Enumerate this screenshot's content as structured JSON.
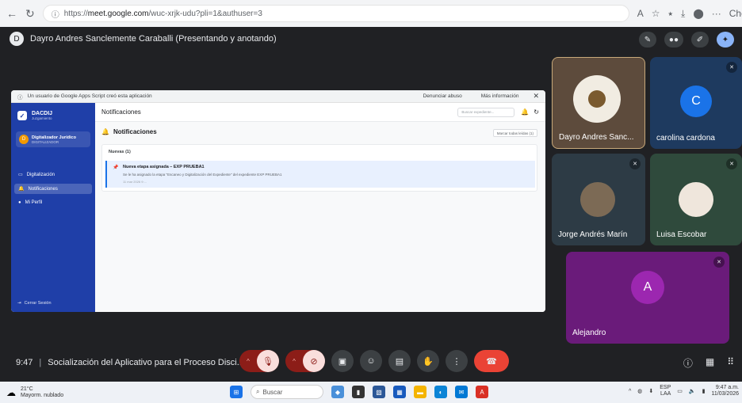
{
  "browser": {
    "url_prefix": "https://",
    "url_host": "meet.google.com",
    "url_path": "/wuc-xrjk-udu?pli=1&authuser=3",
    "profile_label": "Chc"
  },
  "meet": {
    "presenter": {
      "initial": "D",
      "label": "Dayro Andres Sanclemente Caraballi (Presentando y anotando)"
    },
    "meeting_time": "9:47",
    "meeting_title": "Socialización del Aplicativo para el Proceso Disci...",
    "participants": [
      {
        "name": "Dayro Andres Sanc...",
        "kind": "image",
        "color": "#5d4b3c"
      },
      {
        "name": "carolina cardona",
        "initial": "C",
        "kind": "letter",
        "color": "#1a73e8",
        "bg": "#1e3a5f"
      },
      {
        "name": "Jorge Andrés Marín",
        "kind": "image",
        "color": "#2d3b45"
      },
      {
        "name": "Luisa Escobar",
        "kind": "image",
        "color": "#2f4a3c"
      },
      {
        "name": "Alejandro",
        "initial": "A",
        "kind": "letter",
        "color": "#9c27b0",
        "bg": "#6a1b7a"
      }
    ]
  },
  "app": {
    "banner_text": "Un usuario de Google Apps Script creó esta aplicación",
    "banner_report": "Denunciar abuso",
    "banner_more": "Más información",
    "brand_name": "DACDIJ",
    "brand_sub": "Juzgamiento",
    "user_initial": "D",
    "user_name": "Digitalizador Jurídico",
    "user_role": "DIGITALIZADOR",
    "nav": [
      {
        "label": "Digitalización",
        "icon": "▭"
      },
      {
        "label": "Notificaciones",
        "icon": "🔔"
      },
      {
        "label": "Mi Perfil",
        "icon": "●"
      }
    ],
    "logout": "Cerrar Sesión",
    "header_title": "Notificaciones",
    "search_placeholder": "Buscar expediente...",
    "section_title": "Notificaciones",
    "mark_read": "Marcar todas leídas (1)",
    "group_label": "Nuevas (1)",
    "notification": {
      "title": "Nueva etapa asignada – EXP PRUEBA1",
      "body": "Se le ha asignado la etapa \"Escaneo y Digitalización del Expediente\" del expediente EXP PRUEBA1",
      "date": "11 mar 2026 9:..."
    }
  },
  "taskbar": {
    "temp": "21°C",
    "weather": "Mayorm. nublado",
    "search": "Buscar",
    "lang1": "ESP",
    "lang2": "LAA",
    "time": "9:47 a.m.",
    "date": "11/03/2026"
  }
}
